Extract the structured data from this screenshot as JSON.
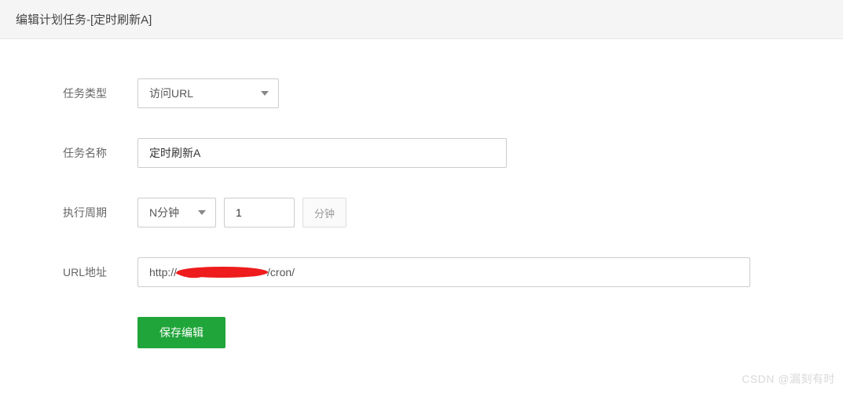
{
  "header": {
    "title": "编辑计划任务-[定时刷新A]"
  },
  "form": {
    "task_type": {
      "label": "任务类型",
      "value": "访问URL"
    },
    "task_name": {
      "label": "任务名称",
      "value": "定时刷新A"
    },
    "cycle": {
      "label": "执行周期",
      "select_value": "N分钟",
      "number_value": "1",
      "unit": "分钟"
    },
    "url": {
      "label": "URL地址",
      "prefix": "http://",
      "suffix": "/cron/"
    },
    "submit_label": "保存编辑"
  },
  "watermark": "CSDN @漏刻有时"
}
